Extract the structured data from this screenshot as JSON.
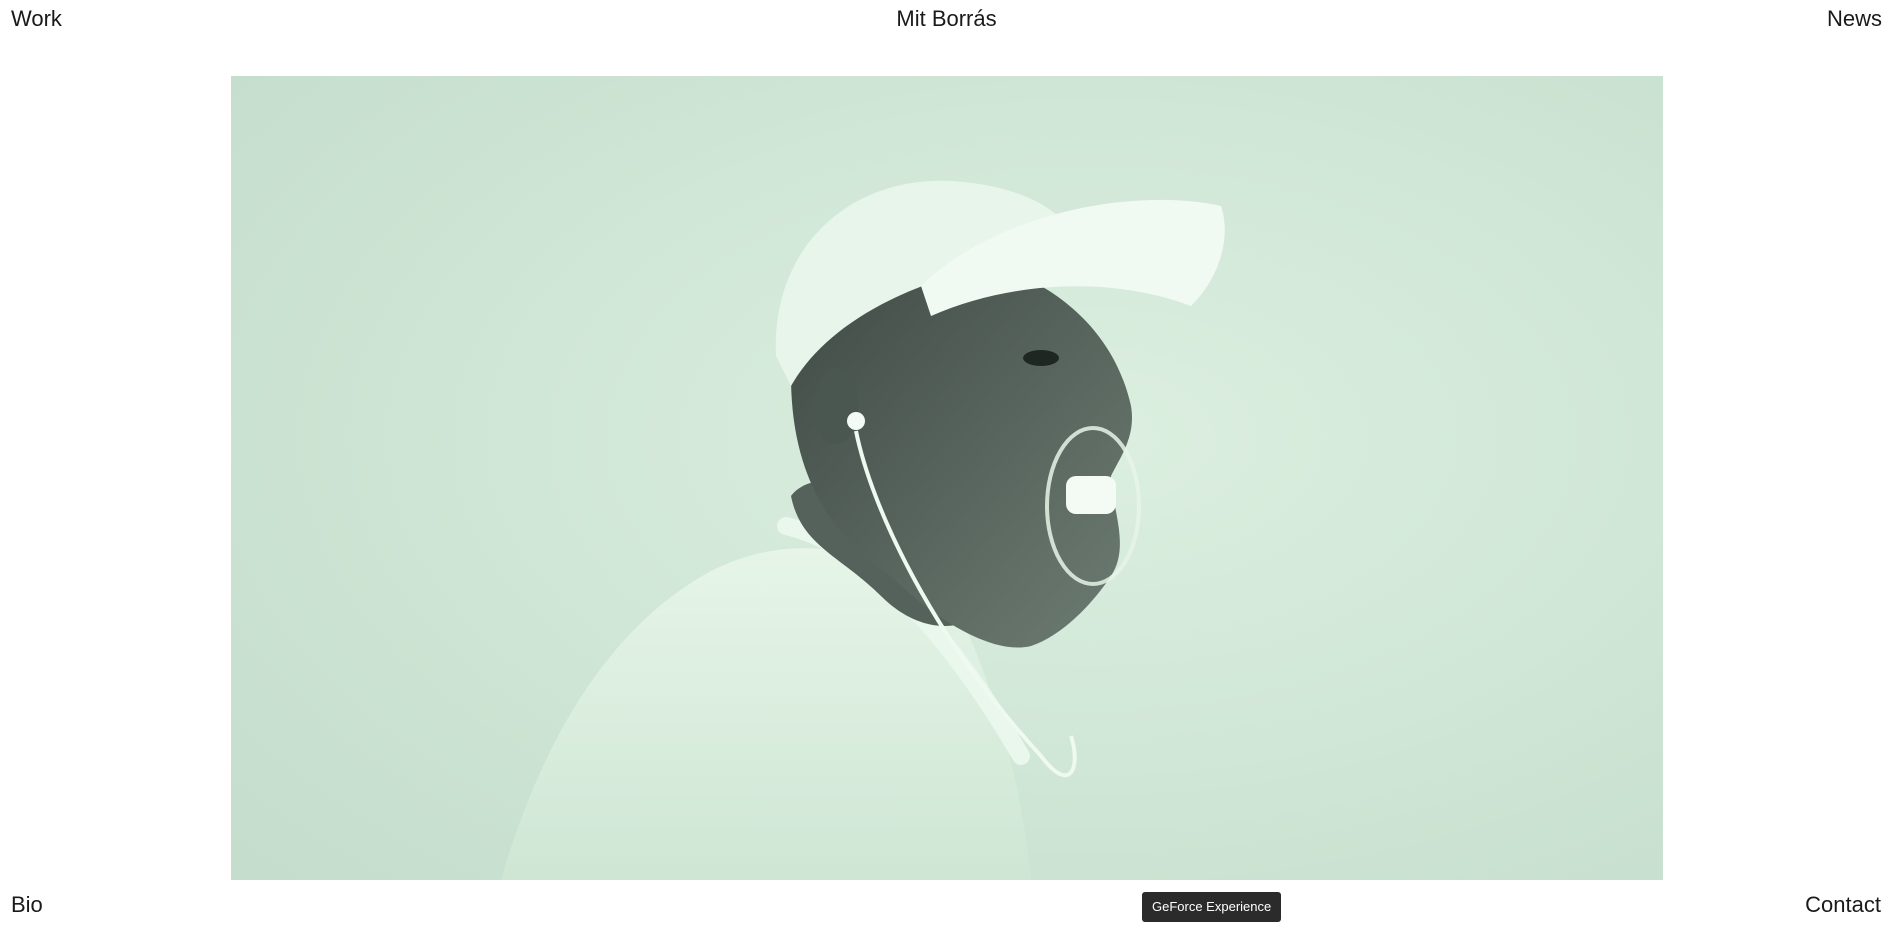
{
  "header": {
    "work_label": "Work",
    "site_title": "Mit Borrás",
    "news_label": "News"
  },
  "footer": {
    "bio_label": "Bio",
    "contact_label": "Contact"
  },
  "tooltip": {
    "text": "GeForce Experience"
  },
  "hero": {
    "alt": "Portrait of man in white cap with earphones and mouth guard",
    "tint_color": "#cfe6d6"
  }
}
